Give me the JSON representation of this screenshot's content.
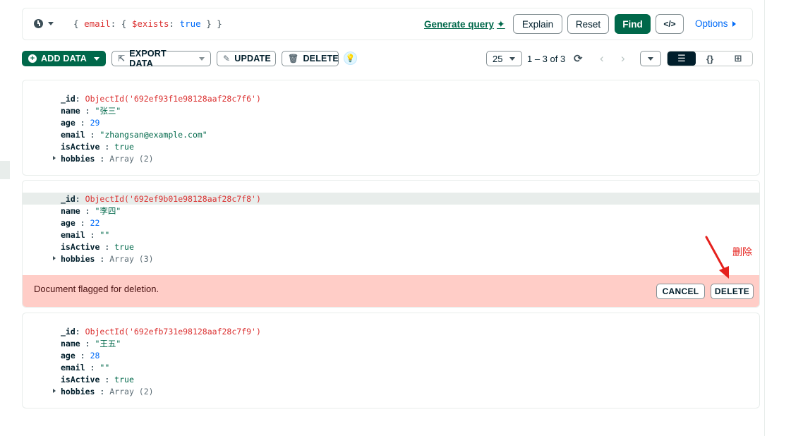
{
  "query": {
    "filter_parts": [
      "{ ",
      "email",
      ": { ",
      "$exists",
      ": ",
      "true",
      " } }"
    ],
    "generate_label": "Generate query",
    "explain_label": "Explain",
    "reset_label": "Reset",
    "find_label": "Find",
    "code_label": "</>",
    "options_label": "Options"
  },
  "toolbar": {
    "add_data_label": "ADD DATA",
    "export_data_label": "EXPORT DATA",
    "update_label": "UPDATE",
    "delete_label": "DELETE",
    "page_size": "25",
    "range_text": "1 – 3 of 3",
    "view_list_label": "☰",
    "view_json_label": "{}",
    "view_table_label": "⊞"
  },
  "documents": [
    {
      "id_key": "_id",
      "id_value": "ObjectId('692ef93f1e98128aaf28c7f6')",
      "name_key": "name",
      "name_value": "\"张三\"",
      "age_key": "age",
      "age_value": "29",
      "email_key": "email",
      "email_value": "\"zhangsan@example.com\"",
      "active_key": "isActive",
      "active_value": "true",
      "hobbies_key": "hobbies",
      "hobbies_value": "Array (2)"
    },
    {
      "id_key": "_id",
      "id_value": "ObjectId('692ef9b01e98128aaf28c7f8')",
      "name_key": "name",
      "name_value": "\"李四\"",
      "age_key": "age",
      "age_value": "22",
      "email_key": "email",
      "email_value": "\"\"",
      "active_key": "isActive",
      "active_value": "true",
      "hobbies_key": "hobbies",
      "hobbies_value": "Array (3)"
    },
    {
      "id_key": "_id",
      "id_value": "ObjectId('692efb731e98128aaf28c7f9')",
      "name_key": "name",
      "name_value": "\"王五\"",
      "age_key": "age",
      "age_value": "28",
      "email_key": "email",
      "email_value": "\"\"",
      "active_key": "isActive",
      "active_value": "true",
      "hobbies_key": "hobbies",
      "hobbies_value": "Array (2)"
    }
  ],
  "deletion_banner": {
    "message": "Document flagged for deletion.",
    "cancel_label": "CANCEL",
    "delete_label": "DELETE"
  },
  "annotation": {
    "text": "删除",
    "color": "#e5211d"
  },
  "colors": {
    "accent_green": "#00684a",
    "link_blue": "#016bf8",
    "flag_bg": "#ffcdc7",
    "objectid_red": "#db3030"
  }
}
